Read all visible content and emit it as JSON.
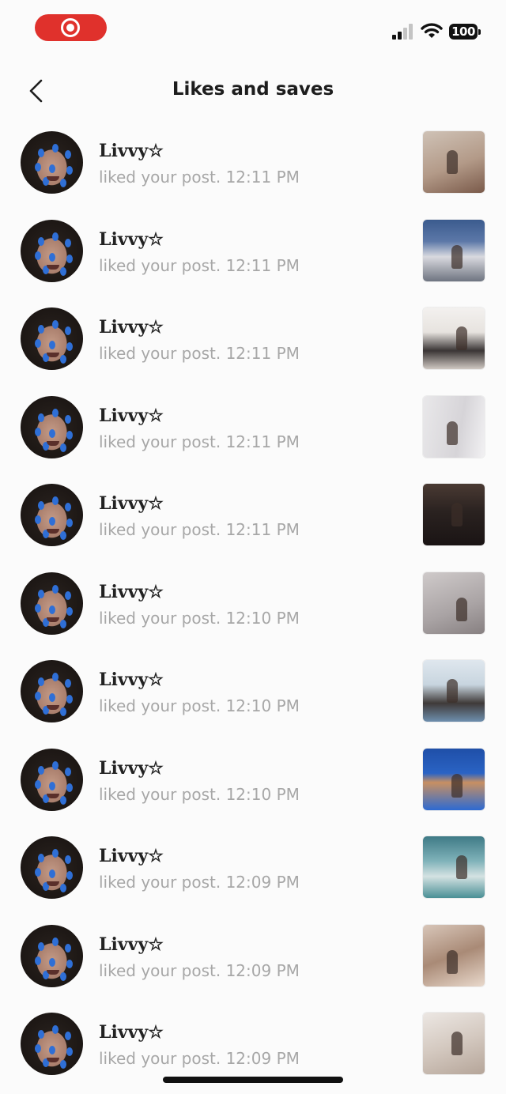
{
  "status_bar": {
    "battery": "100"
  },
  "header": {
    "title": "Likes and saves"
  },
  "notifications": [
    {
      "user": "Livvy☆",
      "text": "liked your post. 12:11 PM",
      "thumb_bg": "linear-gradient(160deg,#cfc2b6 0%,#b39a88 55%,#7a5a4a 100%)",
      "thumb_icon": "ring-light-photo-icon"
    },
    {
      "user": "Livvy☆",
      "text": "liked your post. 12:11 PM",
      "thumb_bg": "linear-gradient(180deg,#3b5b8e 0%,#5c78a8 35%,#d9d9df 60%,#6e7480 100%)",
      "thumb_icon": "city-building-photo-icon"
    },
    {
      "user": "Livvy☆",
      "text": "liked your post. 12:11 PM",
      "thumb_bg": "linear-gradient(180deg,#f3f1ef 0%,#e7e3df 40%,#3a3535 70%,#cfc8c2 100%)",
      "thumb_icon": "white-room-photo-icon"
    },
    {
      "user": "Livvy☆",
      "text": "liked your post. 12:11 PM",
      "thumb_bg": "linear-gradient(100deg,#e9e8ea 0%,#d6d4d8 60%,#f2f1f3 100%)",
      "thumb_icon": "hallway-photo-icon"
    },
    {
      "user": "Livvy☆",
      "text": "liked your post. 12:11 PM",
      "thumb_bg": "linear-gradient(180deg,#4a3a33 0%,#2a2220 45%,#1a1414 100%)",
      "thumb_icon": "avatars-photo-icon"
    },
    {
      "user": "Livvy☆",
      "text": "liked your post. 12:10 PM",
      "thumb_bg": "linear-gradient(160deg,#cfcaca 0%,#a9a3a4 60%,#878081 100%)",
      "thumb_icon": "girl-standing-photo-icon"
    },
    {
      "user": "Livvy☆",
      "text": "liked your post. 12:10 PM",
      "thumb_bg": "linear-gradient(180deg,#dfe7ee 0%,#c8d5df 40%,#3f3a38 70%,#6e8fae 100%)",
      "thumb_icon": "ocean-girl-photo-icon"
    },
    {
      "user": "Livvy☆",
      "text": "liked your post. 12:10 PM",
      "thumb_bg": "linear-gradient(180deg,#1f4fa8 0%,#2a63c4 40%,#c89062 55%,#2d6ad2 100%)",
      "thumb_icon": "beach-photo-icon"
    },
    {
      "user": "Livvy☆",
      "text": "liked your post. 12:09 PM",
      "thumb_bg": "linear-gradient(180deg,#3f7a86 0%,#7fb2b9 40%,#d4e2e2 65%,#4a8f95 100%)",
      "thumb_icon": "seaside-photo-icon"
    },
    {
      "user": "Livvy☆",
      "text": "liked your post. 12:09 PM",
      "thumb_bg": "linear-gradient(160deg,#d8c6b9 0%,#a98a76 50%,#e9d9cc 100%)",
      "thumb_icon": "bedroom-photo-icon"
    },
    {
      "user": "Livvy☆",
      "text": "liked your post. 12:09 PM",
      "thumb_bg": "linear-gradient(160deg,#ece7e3 0%,#d4c9c0 50%,#b5a599 100%)",
      "thumb_icon": "blonde-girl-photo-icon"
    }
  ]
}
